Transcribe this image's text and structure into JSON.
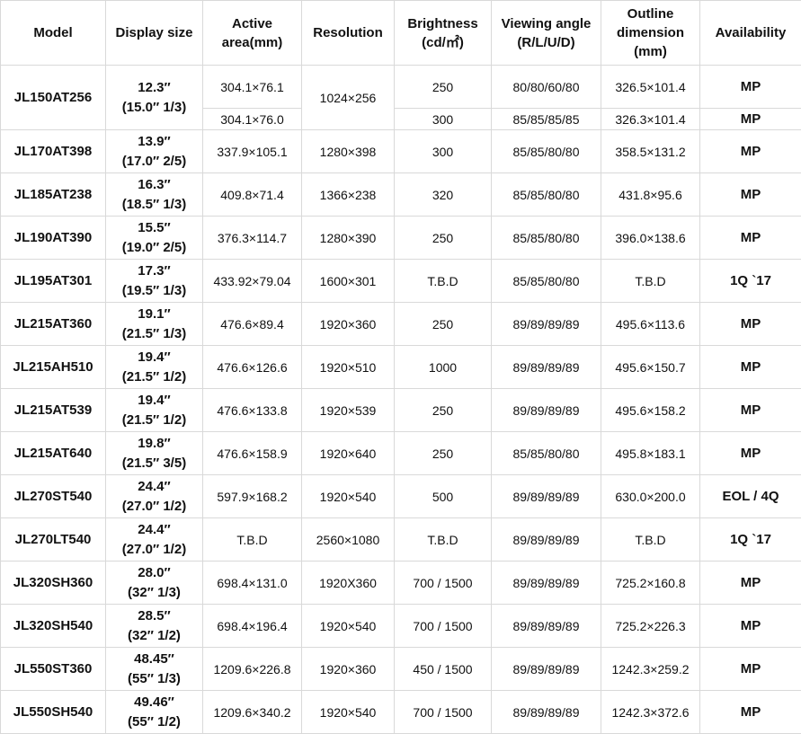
{
  "headers": {
    "model": "Model",
    "display_size": "Display size",
    "active_area": [
      "Active",
      "area(mm)"
    ],
    "resolution": "Resolution",
    "brightness": [
      "Brightness",
      "(cd/㎡)"
    ],
    "viewing_angle": [
      "Viewing angle",
      "(R/L/U/D)"
    ],
    "outline": [
      "Outline",
      "dimension",
      "(mm)"
    ],
    "availability": "Availability"
  },
  "first": {
    "model": "JL150AT256",
    "size": [
      "12.3″",
      "(15.0″ 1/3)"
    ],
    "area_a": "304.1×76.1",
    "area_b": "304.1×76.0",
    "resolution": "1024×256",
    "brightness_a": "250",
    "brightness_b": "300",
    "viewing_a": "80/80/60/80",
    "viewing_b": "85/85/85/85",
    "outline_a": "326.5×101.4",
    "outline_b": "326.3×101.4",
    "avail_a": "MP",
    "avail_b": "MP"
  },
  "rows": [
    {
      "model": "JL170AT398",
      "size": [
        "13.9″",
        "(17.0″ 2/5)"
      ],
      "area": "337.9×105.1",
      "resolution": "1280×398",
      "brightness": "300",
      "viewing": "85/85/80/80",
      "outline": "358.5×131.2",
      "availability": "MP"
    },
    {
      "model": "JL185AT238",
      "size": [
        "16.3″",
        "(18.5″ 1/3)"
      ],
      "area": "409.8×71.4",
      "resolution": "1366×238",
      "brightness": "320",
      "viewing": "85/85/80/80",
      "outline": "431.8×95.6",
      "availability": "MP"
    },
    {
      "model": "JL190AT390",
      "size": [
        "15.5″",
        "(19.0″ 2/5)"
      ],
      "area": "376.3×114.7",
      "resolution": "1280×390",
      "brightness": "250",
      "viewing": "85/85/80/80",
      "outline": "396.0×138.6",
      "availability": "MP"
    },
    {
      "model": "JL195AT301",
      "size": [
        "17.3″",
        "(19.5″ 1/3)"
      ],
      "area": "433.92×79.04",
      "resolution": "1600×301",
      "brightness": "T.B.D",
      "viewing": "85/85/80/80",
      "outline": "T.B.D",
      "availability": "1Q `17"
    },
    {
      "model": "JL215AT360",
      "size": [
        "19.1″",
        "(21.5″ 1/3)"
      ],
      "area": "476.6×89.4",
      "resolution": "1920×360",
      "brightness": "250",
      "viewing": "89/89/89/89",
      "outline": "495.6×113.6",
      "availability": "MP"
    },
    {
      "model": "JL215AH510",
      "size": [
        "19.4″",
        "(21.5″ 1/2)"
      ],
      "area": "476.6×126.6",
      "resolution": "1920×510",
      "brightness": "1000",
      "viewing": "89/89/89/89",
      "outline": "495.6×150.7",
      "availability": "MP"
    },
    {
      "model": "JL215AT539",
      "size": [
        "19.4″",
        "(21.5″ 1/2)"
      ],
      "area": "476.6×133.8",
      "resolution": "1920×539",
      "brightness": "250",
      "viewing": "89/89/89/89",
      "outline": "495.6×158.2",
      "availability": "MP"
    },
    {
      "model": "JL215AT640",
      "size": [
        "19.8″",
        "(21.5″ 3/5)"
      ],
      "area": "476.6×158.9",
      "resolution": "1920×640",
      "brightness": "250",
      "viewing": "85/85/80/80",
      "outline": "495.8×183.1",
      "availability": "MP"
    },
    {
      "model": "JL270ST540",
      "size": [
        "24.4″",
        "(27.0″ 1/2)"
      ],
      "area": "597.9×168.2",
      "resolution": "1920×540",
      "brightness": "500",
      "viewing": "89/89/89/89",
      "outline": "630.0×200.0",
      "availability": "EOL / 4Q"
    },
    {
      "model": "JL270LT540",
      "size": [
        "24.4″",
        "(27.0″ 1/2)"
      ],
      "area": "T.B.D",
      "resolution": "2560×1080",
      "brightness": "T.B.D",
      "viewing": "89/89/89/89",
      "outline": "T.B.D",
      "availability": "1Q `17"
    },
    {
      "model": "JL320SH360",
      "size": [
        "28.0″",
        "(32″ 1/3)"
      ],
      "area": "698.4×131.0",
      "resolution": "1920X360",
      "brightness": "700 / 1500",
      "viewing": "89/89/89/89",
      "outline": "725.2×160.8",
      "availability": "MP"
    },
    {
      "model": "JL320SH540",
      "size": [
        "28.5″",
        "(32″ 1/2)"
      ],
      "area": "698.4×196.4",
      "resolution": "1920×540",
      "brightness": "700 / 1500",
      "viewing": "89/89/89/89",
      "outline": "725.2×226.3",
      "availability": "MP"
    },
    {
      "model": "JL550ST360",
      "size": [
        "48.45″",
        "(55″ 1/3)"
      ],
      "area": "1209.6×226.8",
      "resolution": "1920×360",
      "brightness": "450 / 1500",
      "viewing": "89/89/89/89",
      "outline": "1242.3×259.2",
      "availability": "MP"
    },
    {
      "model": "JL550SH540",
      "size": [
        "49.46″",
        "(55″ 1/2)"
      ],
      "area": "1209.6×340.2",
      "resolution": "1920×540",
      "brightness": "700 / 1500",
      "viewing": "89/89/89/89",
      "outline": "1242.3×372.6",
      "availability": "MP"
    }
  ]
}
